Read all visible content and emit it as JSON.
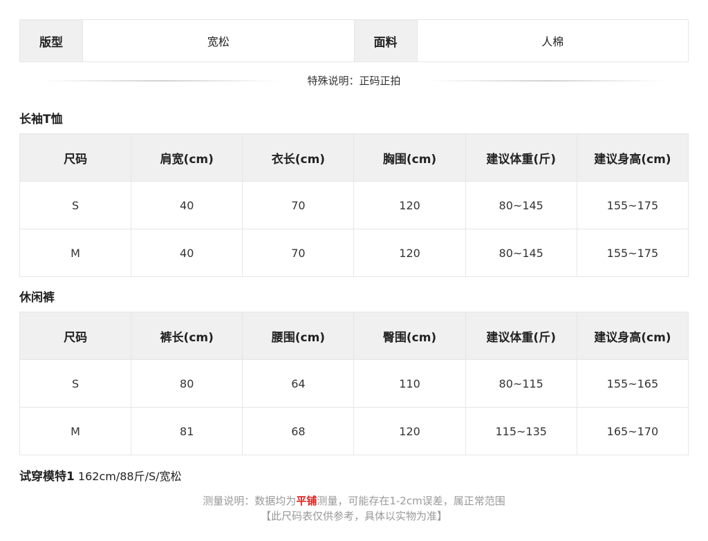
{
  "attributes": {
    "fit_label": "版型",
    "fit_value": "宽松",
    "fabric_label": "面料",
    "fabric_value": "人棉"
  },
  "special_note": "特殊说明：正码正拍",
  "tshirt": {
    "title": "长袖T恤",
    "headers": [
      "尺码",
      "肩宽(cm)",
      "衣长(cm)",
      "胸围(cm)",
      "建议体重(斤)",
      "建议身高(cm)"
    ],
    "rows": [
      [
        "S",
        "40",
        "70",
        "120",
        "80~145",
        "155~175"
      ],
      [
        "M",
        "40",
        "70",
        "120",
        "80~145",
        "155~175"
      ]
    ]
  },
  "pants": {
    "title": "休闲裤",
    "headers": [
      "尺码",
      "裤长(cm)",
      "腰围(cm)",
      "臀围(cm)",
      "建议体重(斤)",
      "建议身高(cm)"
    ],
    "rows": [
      [
        "S",
        "80",
        "64",
        "110",
        "80~115",
        "155~165"
      ],
      [
        "M",
        "81",
        "68",
        "120",
        "115~135",
        "165~170"
      ]
    ]
  },
  "model": {
    "label": "试穿模特1",
    "value": " 162cm/88斤/S/宽松"
  },
  "footer": {
    "line1_pre": "测量说明：数据均为",
    "line1_highlight": "平铺",
    "line1_post": "测量，可能存在1-2cm误差，属正常范围",
    "line2": "【此尺码表仅供参考，具体以实物为准】",
    "highlight_color": "#e02020"
  }
}
